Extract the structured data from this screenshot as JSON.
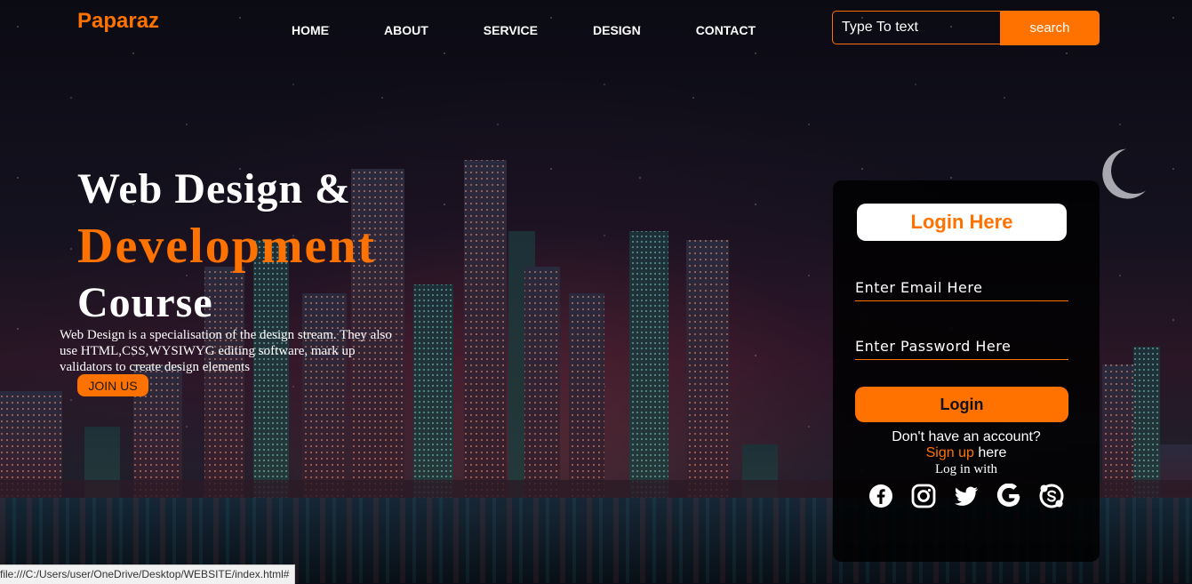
{
  "header": {
    "logo": "Paparaz",
    "nav": [
      "HOME",
      "ABOUT",
      "SERVICE",
      "DESIGN",
      "CONTACT"
    ],
    "search": {
      "placeholder": "Type To text",
      "button": "search"
    }
  },
  "hero": {
    "line1": "Web Design &",
    "line2": "Development",
    "line3": "Course",
    "description": "Web Design is a specialisation of the design stream. They also use HTML,CSS,WYSIWYG editing software, mark up validators to create design elements",
    "join_button": "JOIN US"
  },
  "login": {
    "title": "Login Here",
    "email_placeholder": "Enter Email Here",
    "password_placeholder": "Enter Password Here",
    "button": "Login",
    "no_account": "Don't have an account?",
    "signup_link": "Sign up",
    "signup_suffix": " here",
    "login_with": "Log in with",
    "social_icons": [
      "facebook-icon",
      "instagram-icon",
      "twitter-icon",
      "google-icon",
      "skype-icon"
    ]
  },
  "status_bar": "file:///C:/Users/user/OneDrive/Desktop/WEBSITE/index.html#",
  "colors": {
    "accent": "#ff7200",
    "card_bg": "#000000",
    "text": "#ffffff"
  }
}
